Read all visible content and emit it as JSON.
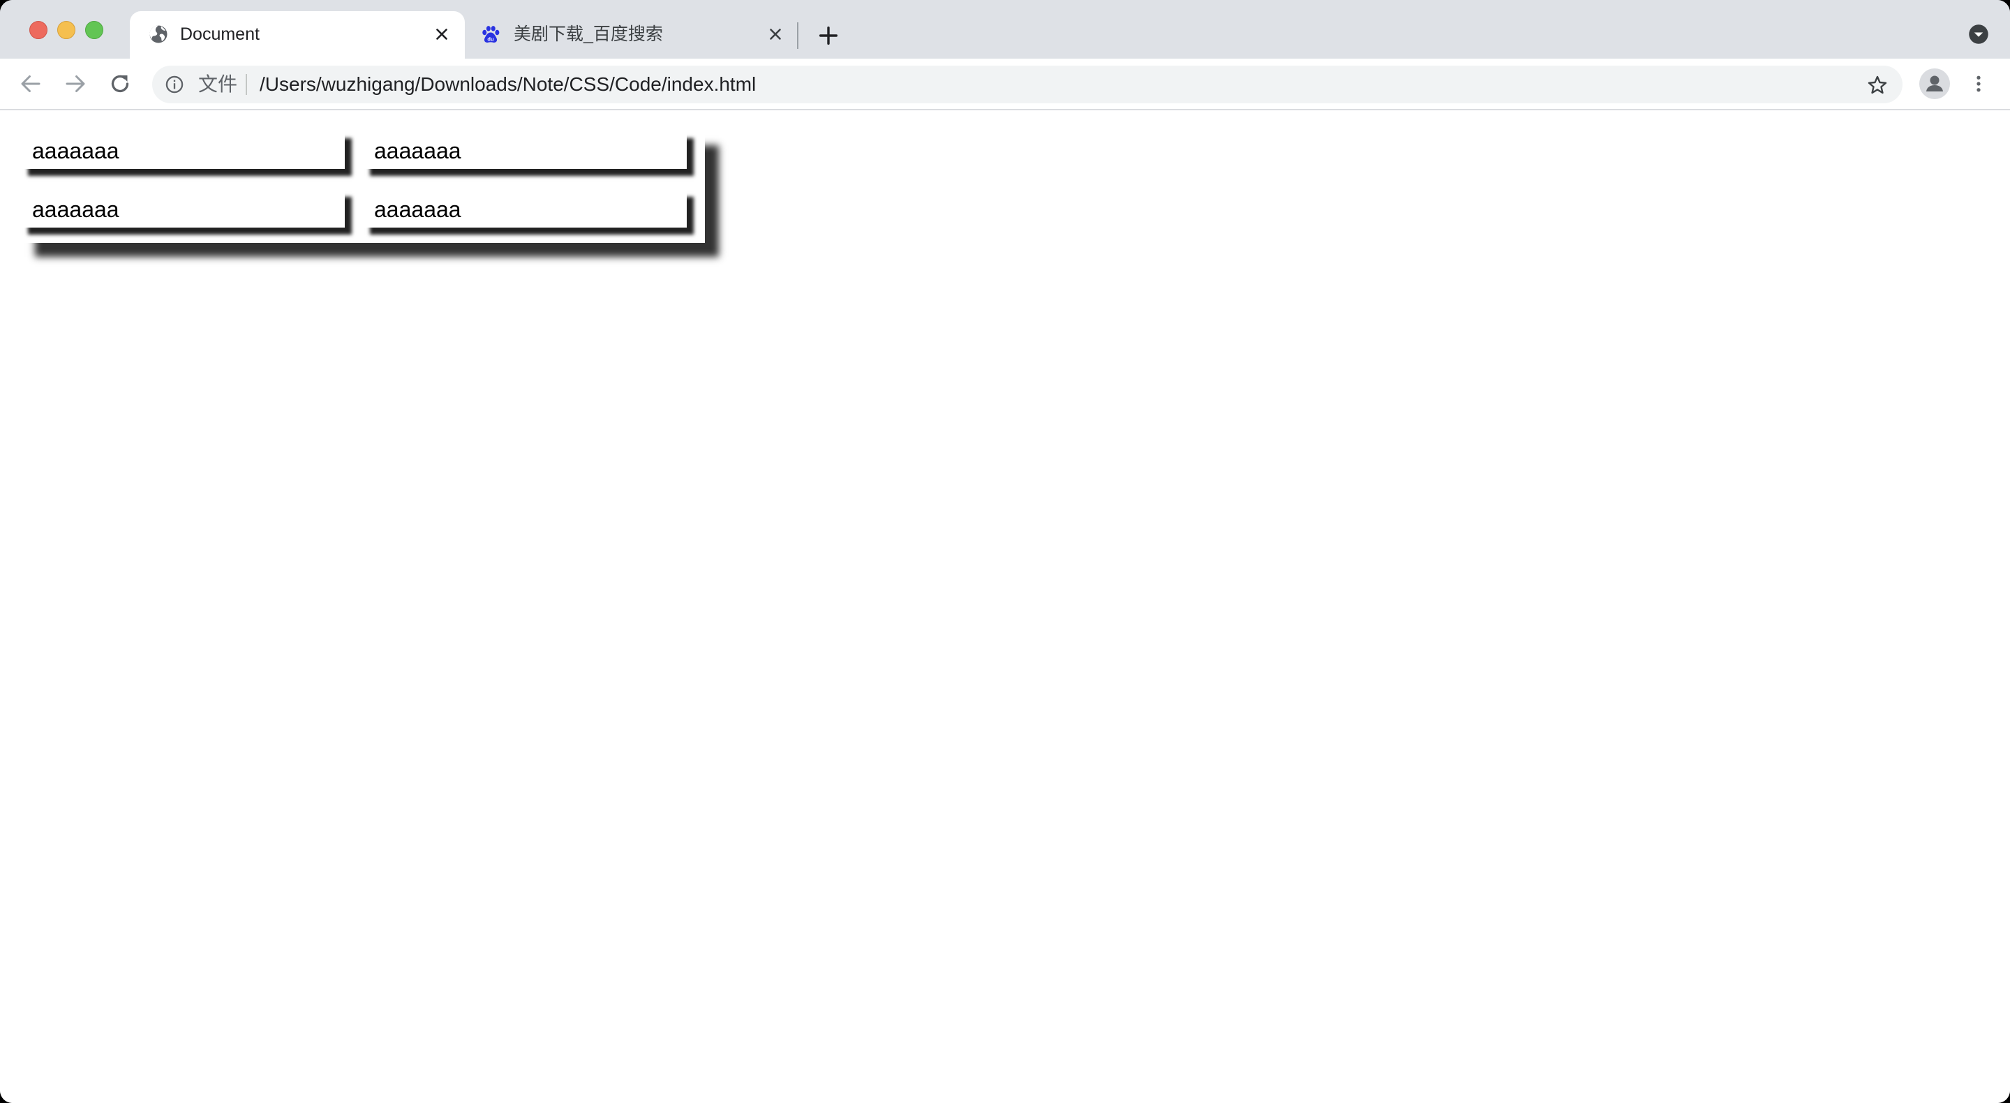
{
  "colors": {
    "tabstrip_bg": "#dee1e6",
    "active_tab_bg": "#ffffff",
    "omnibox_bg": "#f1f3f4",
    "close_red": "#ed6a5e",
    "minimize_yellow": "#f5bf4f",
    "maximize_green": "#62c554",
    "baidu_blue": "#2932e1"
  },
  "tabs": [
    {
      "title": "Document",
      "active": true,
      "icon": "globe-icon"
    },
    {
      "title": "美剧下载_百度搜索",
      "active": false,
      "icon": "baidu-paw-icon"
    }
  ],
  "toolbar": {
    "back_icon": "arrow-left-icon",
    "forward_icon": "arrow-right-icon",
    "reload_icon": "reload-icon",
    "info_icon": "info-icon",
    "scheme_chip": "文件",
    "url": "/Users/wuzhigang/Downloads/Note/CSS/Code/index.html",
    "bookmark_icon": "star-icon",
    "profile_icon": "person-icon",
    "menu_icon": "kebab-menu-icon"
  },
  "page": {
    "cells": [
      {
        "text": "aaaaaaa"
      },
      {
        "text": "aaaaaaa"
      },
      {
        "text": "aaaaaaa"
      },
      {
        "text": "aaaaaaa"
      }
    ]
  }
}
